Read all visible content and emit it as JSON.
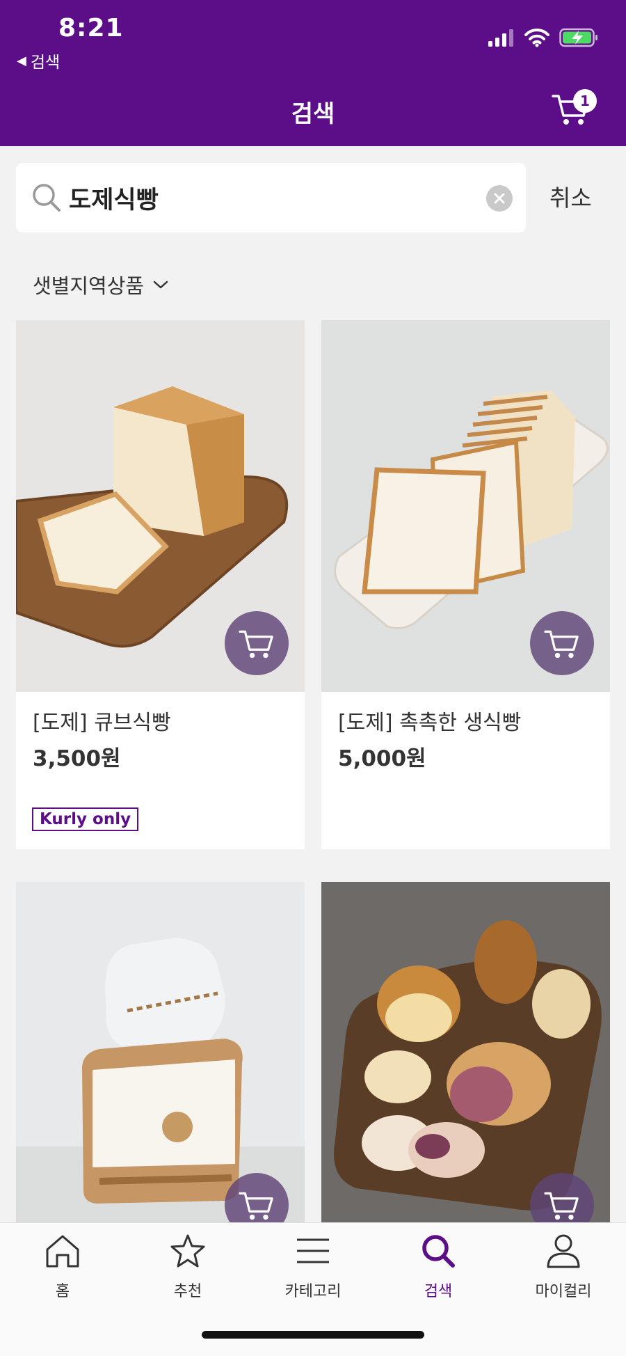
{
  "status_bar": {
    "time": "8:21",
    "back_label": "검색"
  },
  "header": {
    "title": "검색",
    "cart_count": "1"
  },
  "search": {
    "query": "도제식빵",
    "cancel_label": "취소"
  },
  "filter": {
    "label": "샛별지역상품"
  },
  "products": [
    {
      "name": "[도제] 큐브식빵",
      "price": "3,500원",
      "badge": "Kurly only"
    },
    {
      "name": "[도제] 촉촉한 생식빵",
      "price": "5,000원"
    },
    {
      "name": "",
      "price": ""
    },
    {
      "name": "",
      "price": ""
    }
  ],
  "tab_bar": {
    "tabs": [
      {
        "label": "홈",
        "icon": "home-icon"
      },
      {
        "label": "추천",
        "icon": "star-icon"
      },
      {
        "label": "카테고리",
        "icon": "menu-icon"
      },
      {
        "label": "검색",
        "icon": "search-icon",
        "active": true
      },
      {
        "label": "마이컬리",
        "icon": "person-icon"
      }
    ]
  },
  "colors": {
    "brand": "#5b0e87",
    "background": "#f2f2f2",
    "cart_button": "#5f4478"
  }
}
